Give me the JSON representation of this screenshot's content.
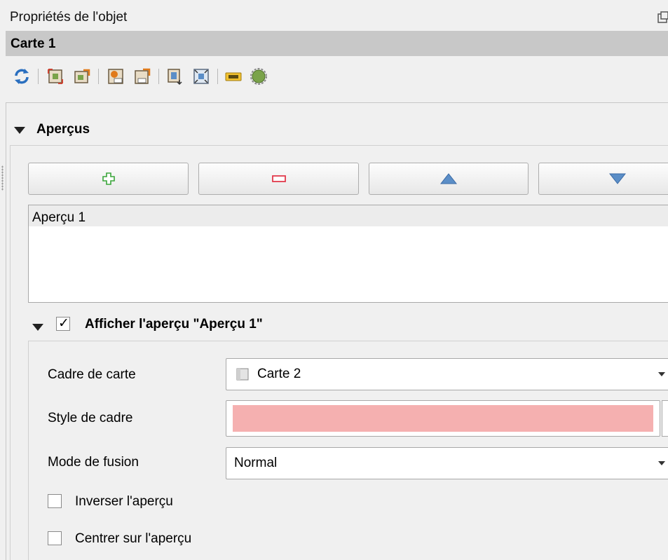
{
  "panel": {
    "title": "Propriétés de l'objet",
    "object_name": "Carte 1"
  },
  "toolbar": {
    "icons": [
      "refresh-icon",
      "set-extent-icon",
      "view-extent-icon",
      "set-scale-icon",
      "view-scale-icon",
      "move-content-icon",
      "zoom-full-icon",
      "label-icon",
      "atlas-icon"
    ]
  },
  "overviews": {
    "title": "Aperçus",
    "items": [
      "Aperçu 1"
    ]
  },
  "overview_settings": {
    "title": "Afficher l'aperçu \"Aperçu 1\"",
    "checked": true,
    "map_frame_label": "Cadre de carte",
    "map_frame_value": "Carte 2",
    "frame_style_label": "Style de cadre",
    "frame_style_color": "#f5b0b0",
    "blend_mode_label": "Mode de fusion",
    "blend_mode_value": "Normal",
    "invert_label": "Inverser l'aperçu",
    "invert_checked": false,
    "center_label": "Centrer sur l'aperçu",
    "center_checked": false
  },
  "colors": {
    "add": "#3aa53a",
    "remove": "#e23a4c",
    "move": "#5b8ec7"
  }
}
